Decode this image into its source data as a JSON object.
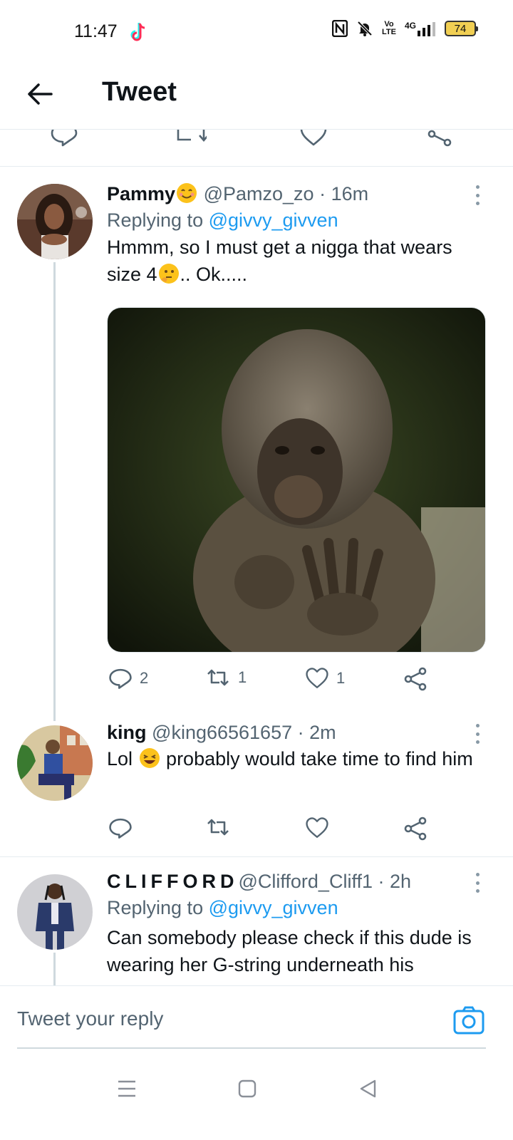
{
  "status_bar": {
    "time": "11:47",
    "network": "4G",
    "volte": "Vo LTE",
    "battery": "74"
  },
  "header": {
    "title": "Tweet"
  },
  "tweets": [
    {
      "name": "Pammy",
      "handle": "@Pamzo_zo",
      "time": "· 16m",
      "replying_prefix": "Replying to ",
      "replying_to": "@givvy_givven",
      "text_part1": "Hmmm, so I must get a nigga that wears size 4",
      "text_part2": ".. Ok.....",
      "replies": "2",
      "retweets": "1",
      "likes": "1"
    },
    {
      "name": "king",
      "handle": "@king66561657",
      "time": "· 2m",
      "text_part1": "Lol ",
      "text_part2": " probably would take time to find him"
    },
    {
      "name": "CLIFFORD",
      "handle": "@Clifford_Cliff1",
      "time": "· 2h",
      "replying_prefix": "Replying to ",
      "replying_to": "@givvy_givven",
      "text": "Can somebody please check if this dude is wearing her G-string underneath his"
    }
  ],
  "reply_bar": {
    "placeholder": "Tweet your reply"
  },
  "colors": {
    "accent": "#1d9bf0",
    "secondary_text": "#536471",
    "divider": "#e6ecf0"
  },
  "icons": [
    "back-arrow-icon",
    "tiktok-icon",
    "nfc-icon",
    "bell-off-icon",
    "signal-icon",
    "battery-icon",
    "reply-icon",
    "retweet-icon",
    "like-icon",
    "share-icon",
    "more-icon",
    "camera-icon",
    "menu-icon",
    "home-square-icon",
    "back-triangle-icon"
  ]
}
